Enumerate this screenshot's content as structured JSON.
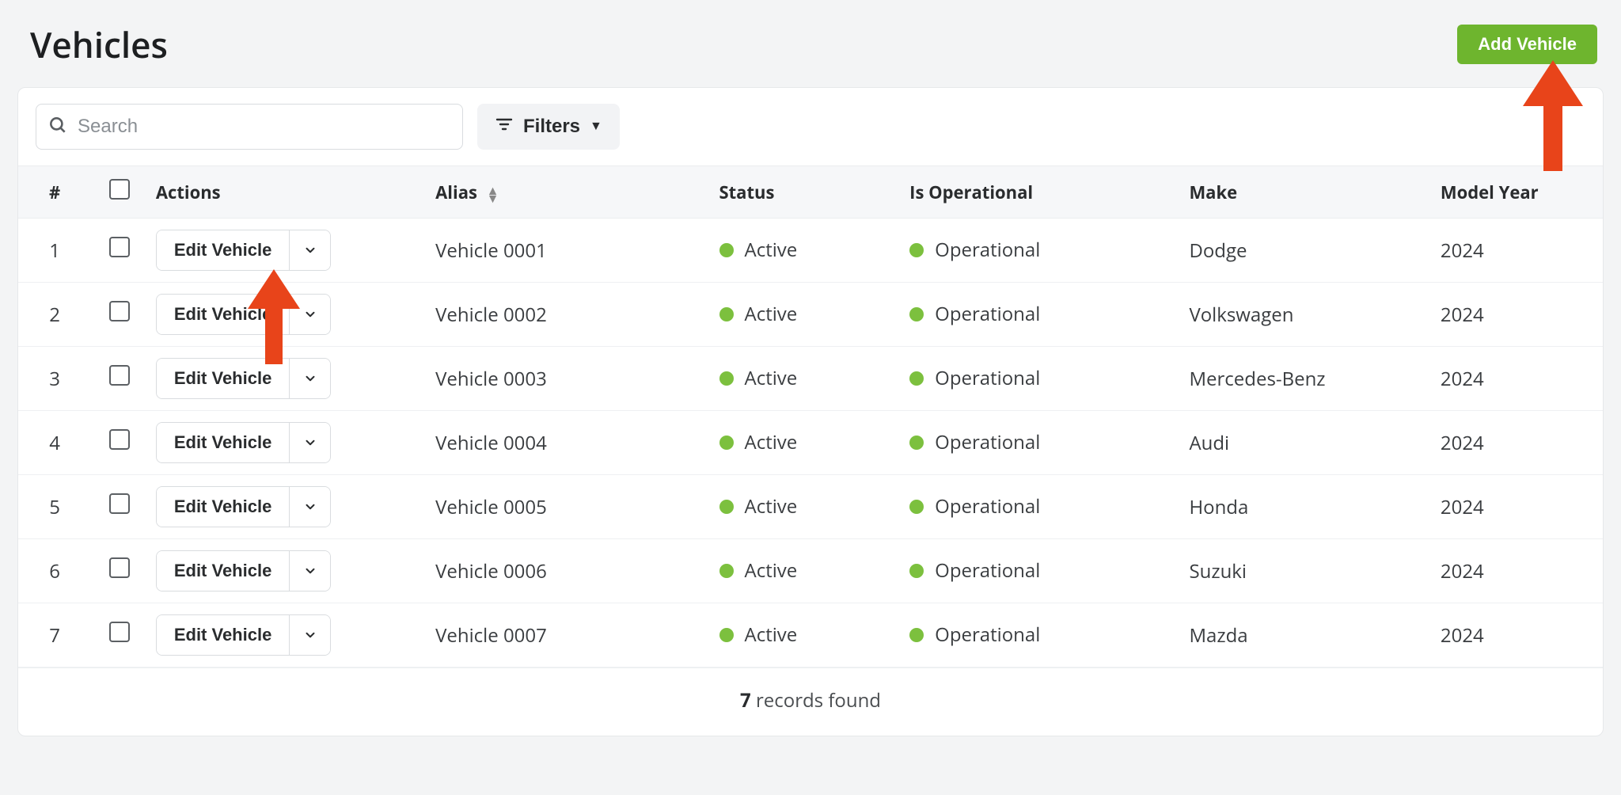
{
  "header": {
    "title": "Vehicles",
    "add_label": "Add Vehicle"
  },
  "toolbar": {
    "search_placeholder": "Search",
    "filters_label": "Filters"
  },
  "columns": {
    "num": "#",
    "actions": "Actions",
    "alias": "Alias",
    "status": "Status",
    "operational": "Is Operational",
    "make": "Make",
    "model_year": "Model Year"
  },
  "row_action_label": "Edit Vehicle",
  "rows": [
    {
      "num": "1",
      "alias": "Vehicle 0001",
      "status": "Active",
      "operational": "Operational",
      "make": "Dodge",
      "year": "2024"
    },
    {
      "num": "2",
      "alias": "Vehicle 0002",
      "status": "Active",
      "operational": "Operational",
      "make": "Volkswagen",
      "year": "2024"
    },
    {
      "num": "3",
      "alias": "Vehicle 0003",
      "status": "Active",
      "operational": "Operational",
      "make": "Mercedes-Benz",
      "year": "2024"
    },
    {
      "num": "4",
      "alias": "Vehicle 0004",
      "status": "Active",
      "operational": "Operational",
      "make": "Audi",
      "year": "2024"
    },
    {
      "num": "5",
      "alias": "Vehicle 0005",
      "status": "Active",
      "operational": "Operational",
      "make": "Honda",
      "year": "2024"
    },
    {
      "num": "6",
      "alias": "Vehicle 0006",
      "status": "Active",
      "operational": "Operational",
      "make": "Suzuki",
      "year": "2024"
    },
    {
      "num": "7",
      "alias": "Vehicle 0007",
      "status": "Active",
      "operational": "Operational",
      "make": "Mazda",
      "year": "2024"
    }
  ],
  "footer": {
    "count": "7",
    "records_found": " records found"
  },
  "colors": {
    "primary_green": "#6eb52e",
    "status_dot": "#7cc03e",
    "annotation_red": "#e8441a"
  }
}
